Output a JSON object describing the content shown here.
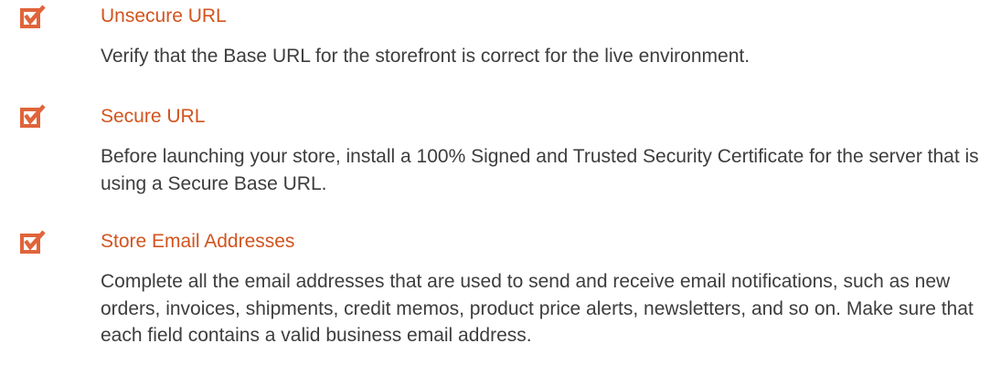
{
  "colors": {
    "accent": "#d2541e",
    "checkbox": "#e0643a",
    "body_text": "#3d3d3d",
    "background": "#ffffff"
  },
  "checklist": [
    {
      "icon": "checked-box-icon",
      "title": "Unsecure URL",
      "description": "Verify that the Base URL for the storefront is correct for the live environment."
    },
    {
      "icon": "checked-box-icon",
      "title": "Secure URL",
      "description": "Before launching your store, install a 100% Signed and Trusted Security Certificate for the server that is using a Secure Base URL."
    },
    {
      "icon": "checked-box-icon",
      "title": "Store Email Addresses",
      "description": "Complete all the email addresses that are used to send and receive email notifications, such as new orders, invoices, shipments, credit memos, product price alerts, newsletters, and so on. Make sure that each field contains a valid business email address."
    }
  ]
}
